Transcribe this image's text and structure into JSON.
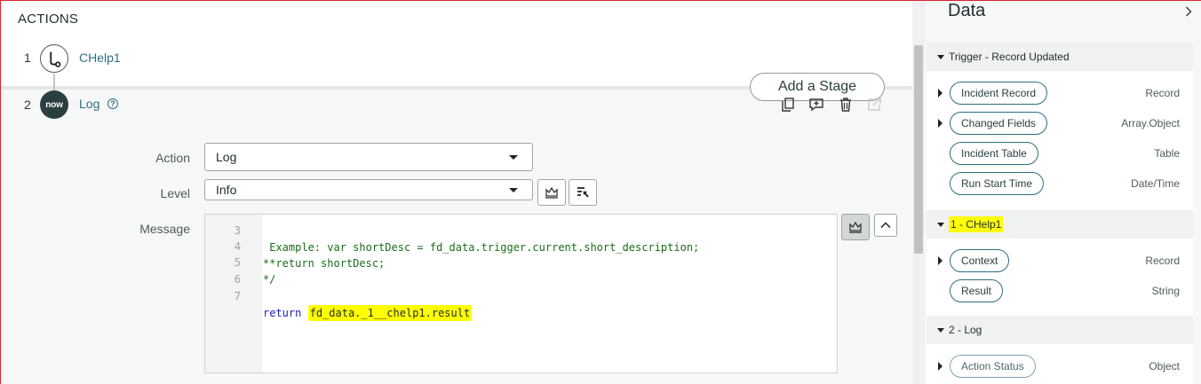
{
  "actions": {
    "title": "ACTIONS",
    "steps": [
      {
        "number": "1",
        "label": "CHelp1",
        "icon": "flow-logic-icon"
      },
      {
        "number": "2",
        "label": "Log",
        "icon": "now-logo-icon",
        "icon_text": "now"
      }
    ],
    "help_icon": "?",
    "add_stage_label": "Add a Stage",
    "toolbar_icons": [
      "copy-icon",
      "comment-add-icon",
      "delete-icon",
      "open-external-icon"
    ]
  },
  "form": {
    "action_label": "Action",
    "action_value": "Log",
    "level_label": "Level",
    "level_value": "Info",
    "message_label": "Message"
  },
  "editor": {
    "lines": [
      {
        "number": "3",
        "text": " Example: var shortDesc = fd_data.trigger.current.short_description;"
      },
      {
        "number": "4",
        "text": "**return shortDesc;"
      },
      {
        "number": "5",
        "text": "*/"
      },
      {
        "number": "6",
        "text": ""
      },
      {
        "number": "7",
        "keyword": "return",
        "highlight": "fd_data._1__chelp1.result"
      }
    ]
  },
  "data_panel": {
    "title": "Data",
    "sections": [
      {
        "label": "Trigger - Record Updated",
        "items": [
          {
            "label": "Incident Record",
            "type": "Record",
            "expandable": true
          },
          {
            "label": "Changed Fields",
            "type": "Array.Object",
            "expandable": true
          },
          {
            "label": "Incident Table",
            "type": "Table",
            "expandable": false
          },
          {
            "label": "Run Start Time",
            "type": "Date/Time",
            "expandable": false
          }
        ]
      },
      {
        "label": "1 - CHelp1",
        "items": [
          {
            "label": "Context",
            "type": "Record",
            "expandable": true
          },
          {
            "label": "Result",
            "type": "String",
            "expandable": false
          }
        ]
      },
      {
        "label": "2 - Log",
        "items": [
          {
            "label": "Action Status",
            "type": "Object",
            "expandable": true
          }
        ]
      }
    ]
  },
  "colors": {
    "accent": "#2e6f82",
    "highlight": "#ffff00",
    "now_icon": "#2b3e40"
  }
}
